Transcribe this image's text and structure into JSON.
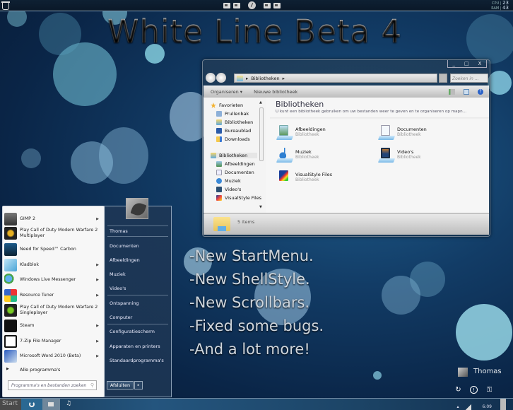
{
  "topbar": {
    "cpu_label": "CPU",
    "cpu_value": "23",
    "ram_label": "RAM",
    "ram_value": "43",
    "dock_icons": [
      "folder-icon",
      "document-folder-icon",
      "clock-icon",
      "music-folder-icon",
      "pictures-folder-icon"
    ]
  },
  "wallpaper": {
    "title": "White Line Beta 4",
    "features": [
      "-New StartMenu.",
      "-New ShellStyle.",
      "-New Scrollbars.",
      "-Fixed some bugs.",
      "-And a lot more!"
    ]
  },
  "explorer": {
    "window_controls": [
      "_",
      "□",
      "X"
    ],
    "address": {
      "separator": "▸",
      "path": "Bibliotheken",
      "trail": "▸"
    },
    "search_placeholder": "Zoeken in ...",
    "toolbar": {
      "organize": "Organiseren ▾",
      "new_library": "Nieuwe bibliotheek"
    },
    "nav": {
      "favorites_header": "Favorieten",
      "favorites": [
        "Prullenbak",
        "Bibliotheken",
        "Bureaublad",
        "Downloads"
      ],
      "libraries_header": "Bibliotheken",
      "libraries": [
        "Afbeeldingen",
        "Documenten",
        "Muziek",
        "Video's",
        "VisualStyle Files"
      ]
    },
    "content": {
      "heading": "Bibliotheken",
      "description": "U kunt een bibliotheek gebruiken om uw bestanden weer te geven en te organiseren op mapn...",
      "items": [
        {
          "name": "Afbeeldingen",
          "type": "Bibliotheek"
        },
        {
          "name": "Documenten",
          "type": "Bibliotheek"
        },
        {
          "name": "Muziek",
          "type": "Bibliotheek"
        },
        {
          "name": "Video's",
          "type": "Bibliotheek"
        },
        {
          "name": "VisualStyle Files",
          "type": "Bibliotheek"
        }
      ]
    },
    "status": "5 items"
  },
  "start_menu": {
    "programs": [
      {
        "label": "GIMP 2",
        "arrow": true
      },
      {
        "label": "Play Call of Duty Modern Warfare 2 Multiplayer",
        "arrow": false
      },
      {
        "label": "Need for Speed™ Carbon",
        "arrow": false
      },
      {
        "label": "Kladblok",
        "arrow": true
      },
      {
        "label": "Windows Live Messenger",
        "arrow": true
      },
      {
        "label": "Resource Tuner",
        "arrow": true
      },
      {
        "label": "Play Call of Duty Modern Warfare 2 Singleplayer",
        "arrow": false
      },
      {
        "label": "Steam",
        "arrow": true
      },
      {
        "label": "7-Zip File Manager",
        "arrow": true
      },
      {
        "label": "Microsoft Word 2010 (Beta)",
        "arrow": true
      }
    ],
    "all_programs": "Alle programma's",
    "search_placeholder": "Programma's en bestanden zoeken",
    "right_links": [
      "Thomas",
      "Documenten",
      "Afbeeldingen",
      "Muziek",
      "Video's",
      "Ontspanning",
      "Computer",
      "Configuratiescherm",
      "Apparaten en printers",
      "Standaardprogramma's"
    ],
    "shutdown": "Afsluiten",
    "shutdown_arrow": "▸"
  },
  "user_widget": {
    "name": "Thomas"
  },
  "taskbar": {
    "start": "Start",
    "clock": "6:09",
    "tray_arrow": "▴"
  }
}
